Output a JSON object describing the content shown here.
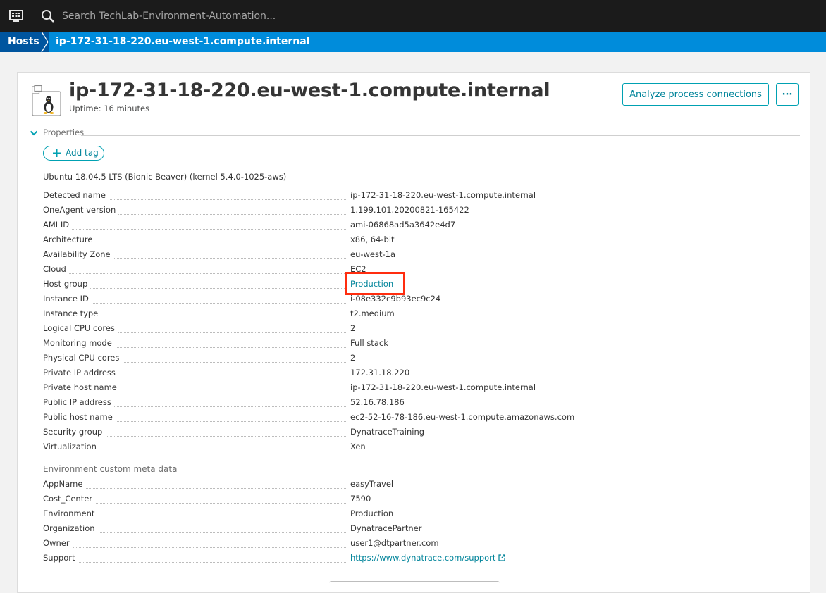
{
  "topbar": {
    "search_placeholder": "Search TechLab-Environment-Automation..."
  },
  "breadcrumb": {
    "root": "Hosts",
    "current": "ip-172-31-18-220.eu-west-1.compute.internal"
  },
  "host": {
    "title": "ip-172-31-18-220.eu-west-1.compute.internal",
    "uptime": "Uptime: 16 minutes",
    "icon": "linux-tux-icon"
  },
  "actions": {
    "analyze_label": "Analyze process connections",
    "more_label": "···"
  },
  "properties": {
    "toggle_label": "Properties",
    "add_tag_label": "Add tag",
    "os": "Ubuntu 18.04.5 LTS (Bionic Beaver) (kernel 5.4.0-1025-aws)",
    "rows": [
      {
        "key": "Detected name",
        "value": "ip-172-31-18-220.eu-west-1.compute.internal"
      },
      {
        "key": "OneAgent version",
        "value": "1.199.101.20200821-165422"
      },
      {
        "key": "AMI ID",
        "value": "ami-06868ad5a3642e4d7"
      },
      {
        "key": "Architecture",
        "value": "x86, 64-bit"
      },
      {
        "key": "Availability Zone",
        "value": "eu-west-1a"
      },
      {
        "key": "Cloud",
        "value": "EC2"
      },
      {
        "key": "Host group",
        "value": "Production"
      },
      {
        "key": "Instance ID",
        "value": "i-08e332c9b93ec9c24"
      },
      {
        "key": "Instance type",
        "value": "t2.medium"
      },
      {
        "key": "Logical CPU cores",
        "value": "2"
      },
      {
        "key": "Monitoring mode",
        "value": "Full stack"
      },
      {
        "key": "Physical CPU cores",
        "value": "2"
      },
      {
        "key": "Private IP address",
        "value": "172.31.18.220"
      },
      {
        "key": "Private host name",
        "value": "ip-172-31-18-220.eu-west-1.compute.internal"
      },
      {
        "key": "Public IP address",
        "value": "52.16.78.186"
      },
      {
        "key": "Public host name",
        "value": "ec2-52-16-78-186.eu-west-1.compute.amazonaws.com"
      },
      {
        "key": "Security group",
        "value": "DynatraceTraining"
      },
      {
        "key": "Virtualization",
        "value": "Xen"
      }
    ]
  },
  "custom_meta": {
    "heading": "Environment custom meta data",
    "rows": [
      {
        "key": "AppName",
        "value": "easyTravel"
      },
      {
        "key": "Cost_Center",
        "value": "7590"
      },
      {
        "key": "Environment",
        "value": "Production"
      },
      {
        "key": "Organization",
        "value": "DynatracePartner"
      },
      {
        "key": "Owner",
        "value": "user1@dtpartner.com"
      },
      {
        "key": "Support",
        "value": "https://www.dynatrace.com/support"
      }
    ]
  },
  "colors": {
    "topbar": "#1b1b1b",
    "breadcrumb_bar": "#008cdb",
    "breadcrumb_root": "#00559f",
    "link": "#00849a",
    "highlight": "#ff2d0f"
  }
}
